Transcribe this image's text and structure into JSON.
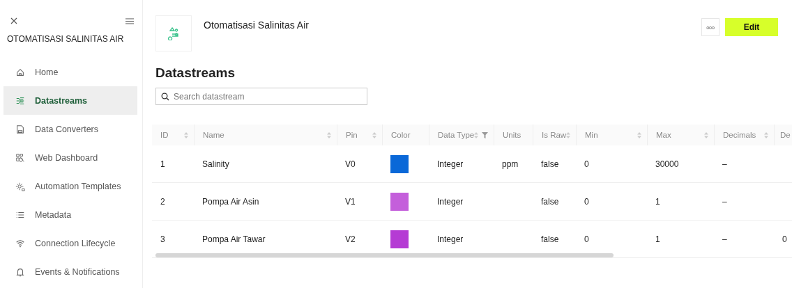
{
  "sidebar": {
    "title": "OTOMATISASI SALINITAS AIR",
    "items": [
      {
        "label": "Home",
        "selected": false
      },
      {
        "label": "Datastreams",
        "selected": true
      },
      {
        "label": "Data Converters",
        "selected": false
      },
      {
        "label": "Web Dashboard",
        "selected": false
      },
      {
        "label": "Automation Templates",
        "selected": false
      },
      {
        "label": "Metadata",
        "selected": false
      },
      {
        "label": "Connection Lifecycle",
        "selected": false
      },
      {
        "label": "Events & Notifications",
        "selected": false
      }
    ]
  },
  "header": {
    "title": "Otomatisasi Salinitas Air",
    "more_button": "ooo",
    "edit_button": "Edit"
  },
  "page_title": "Datastreams",
  "search": {
    "placeholder": "Search datastream"
  },
  "table": {
    "columns": [
      {
        "label": "ID",
        "sortable": true,
        "filter": false
      },
      {
        "label": "Name",
        "sortable": true,
        "filter": false
      },
      {
        "label": "Pin",
        "sortable": true,
        "filter": false
      },
      {
        "label": "Color",
        "sortable": false,
        "filter": false
      },
      {
        "label": "Data Type",
        "sortable": true,
        "filter": true
      },
      {
        "label": "Units",
        "sortable": false,
        "filter": false
      },
      {
        "label": "Is Raw",
        "sortable": true,
        "filter": false
      },
      {
        "label": "Min",
        "sortable": true,
        "filter": false
      },
      {
        "label": "Max",
        "sortable": true,
        "filter": false
      },
      {
        "label": "Decimals",
        "sortable": true,
        "filter": false
      },
      {
        "label": "De"
      }
    ],
    "rows": [
      {
        "id": "1",
        "name": "Salinity",
        "pin": "V0",
        "color": "#0a68d8",
        "data_type": "Integer",
        "units": "ppm",
        "is_raw": "false",
        "min": "0",
        "max": "30000",
        "decimals": "–"
      },
      {
        "id": "2",
        "name": "Pompa Air Asin",
        "pin": "V1",
        "color": "#c45fdb",
        "data_type": "Integer",
        "is_raw": "false",
        "min": "0",
        "max": "1",
        "decimals": "–"
      },
      {
        "id": "3",
        "name": "Pompa Air Tawar",
        "pin": "V2",
        "color": "#b53bd4",
        "data_type": "Integer",
        "is_raw": "false",
        "min": "0",
        "max": "1",
        "decimals": "–",
        "column_11": "0"
      }
    ]
  }
}
